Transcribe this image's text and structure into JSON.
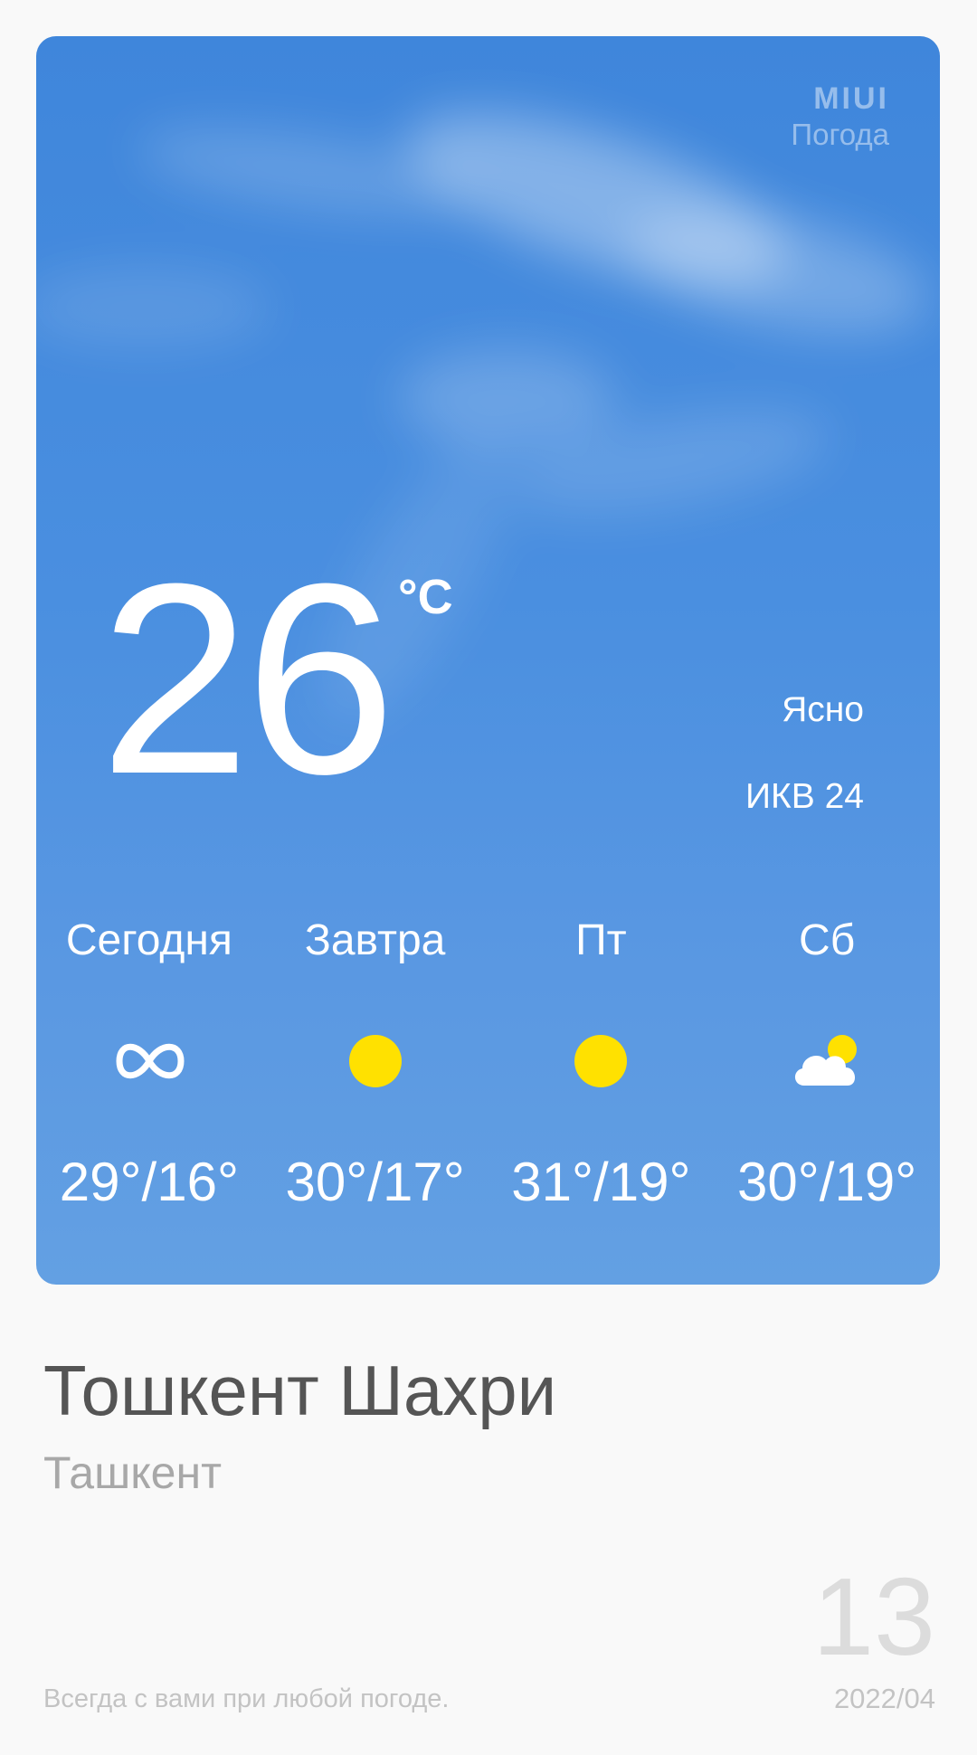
{
  "widget": {
    "brand_logo": "MIUI",
    "brand_app": "Погода",
    "temperature": "26",
    "unit": "°C",
    "condition": "Ясно",
    "aqi": "ИКВ 24",
    "accent_sky": "#4a8fe0",
    "forecast": [
      {
        "day": "Сегодня",
        "icon": "haze-icon",
        "temps": "29°/16°"
      },
      {
        "day": "Завтра",
        "icon": "sun-icon",
        "temps": "30°/17°"
      },
      {
        "day": "Пт",
        "icon": "sun-icon",
        "temps": "31°/19°"
      },
      {
        "day": "Сб",
        "icon": "partly-cloudy-icon",
        "temps": "30°/19°"
      }
    ]
  },
  "location": {
    "city": "Тошкент Шахри",
    "subtitle": "Ташкент"
  },
  "footer": {
    "tagline": "Всегда с вами при любой погоде.",
    "day": "13",
    "year_month": "2022/04"
  }
}
